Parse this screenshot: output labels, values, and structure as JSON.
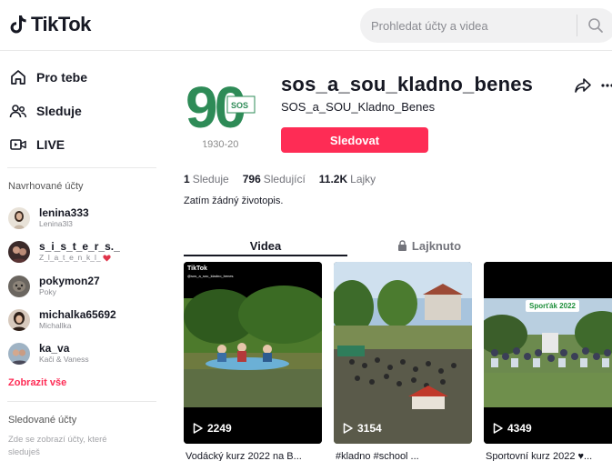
{
  "header": {
    "logo_text": "TikTok",
    "search_placeholder": "Prohledat účty a videa"
  },
  "sidebar": {
    "nav": [
      {
        "label": "Pro tebe",
        "icon": "home-icon"
      },
      {
        "label": "Sleduje",
        "icon": "following-icon"
      },
      {
        "label": "LIVE",
        "icon": "live-icon"
      }
    ],
    "suggested_title": "Navrhované účty",
    "suggested": [
      {
        "name": "lenina333",
        "sub": "Lenina3l3"
      },
      {
        "name": "s_i_s_t_e_r_s._",
        "sub": "Z_l_a_t_e_n_k_l_"
      },
      {
        "name": "pokymon27",
        "sub": "Poky"
      },
      {
        "name": "michalka65692",
        "sub": "Michallka"
      },
      {
        "name": "ka_va",
        "sub": "Kači & Vaness"
      }
    ],
    "show_all": "Zobrazit vše",
    "followed_title": "Sledované účty",
    "followed_empty": "Zde se zobrazí účty, které sleduješ"
  },
  "profile": {
    "username": "sos_a_sou_kladno_benes",
    "display_name": "SOS_a_SOU_Kladno_Benes",
    "follow_label": "Sledovat",
    "avatar_text": "90",
    "avatar_years": "1930-20",
    "stats": {
      "following_count": "1",
      "following_label": "Sleduje",
      "followers_count": "796",
      "followers_label": "Sledující",
      "likes_count": "11.2K",
      "likes_label": "Lajky"
    },
    "bio": "Zatím žádný životopis."
  },
  "tabs": {
    "videos": "Videa",
    "liked": "Lajknuto"
  },
  "videos": [
    {
      "views": "2249",
      "caption": "Vodácký kurz 2022 na B...",
      "watermark": "TikTok",
      "watermark_user": "@sos_a_sou_kladno_benes"
    },
    {
      "views": "3154",
      "caption": "#kladno #school ..."
    },
    {
      "views": "4349",
      "caption": "Sportovní kurz 2022 ♥...",
      "badge": "Sporťák 2022"
    }
  ],
  "colors": {
    "accent": "#fe2c55",
    "text": "#161823",
    "muted": "#73747b"
  }
}
